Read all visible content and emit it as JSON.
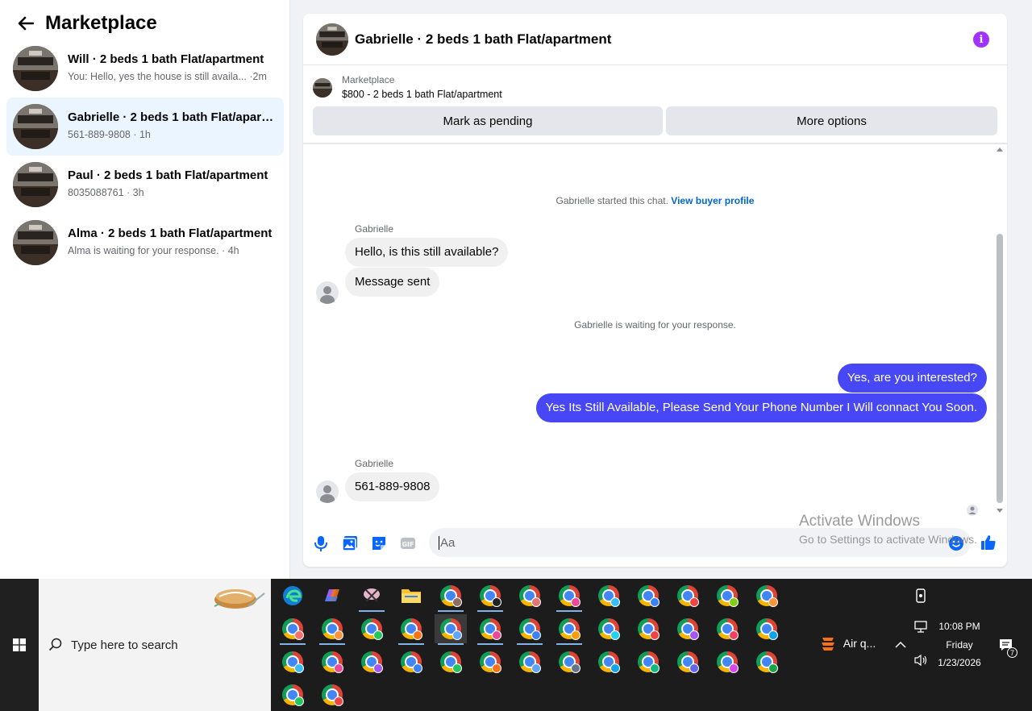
{
  "sidebar": {
    "title": "Marketplace",
    "conversations": [
      {
        "title": "Will · 2 beds 1 bath Flat/apartment",
        "subtitle": "You: Hello, yes the house is still availa... ·2m",
        "active": false
      },
      {
        "title": "Gabrielle · 2 beds 1 bath Flat/apartm...",
        "subtitle": "561-889-9808 · 1h",
        "active": true
      },
      {
        "title": "Paul · 2 beds 1 bath Flat/apartment",
        "subtitle": "8035088761 · 3h",
        "active": false
      },
      {
        "title": "Alma · 2 beds 1 bath Flat/apartment",
        "subtitle": "Alma is waiting for your response. · 4h",
        "active": false
      }
    ]
  },
  "chat": {
    "title": "Gabrielle · 2 beds 1 bath Flat/apartment",
    "listing_label": "Marketplace",
    "listing_price": "$800 - 2 beds 1 bath Flat/apartment",
    "mark_pending": "Mark as pending",
    "more_options": "More options",
    "started_text": "Gabrielle started this chat.",
    "view_buyer": "View buyer profile",
    "sender_name": "Gabrielle",
    "msg_in_1": "Hello, is this still available?",
    "msg_in_2": "Message sent",
    "waiting_text": "Gabrielle is waiting for your response.",
    "msg_out_1": "Yes, are you interested?",
    "msg_out_2": "Yes Its Still Available, Please Send Your Phone Number I Will connact You Soon.",
    "msg_in_3": "561-889-9808",
    "input_placeholder": "Aa",
    "accent_color": "#4747f5"
  },
  "watermark": {
    "line1": "Activate Windows",
    "line2": "Go to Settings to activate Windows."
  },
  "taskbar": {
    "search_placeholder": "Type here to search",
    "weather": "Air q...",
    "time": "10:08 PM",
    "day": "Friday",
    "date": "1/23/2026",
    "notifications": "7"
  }
}
